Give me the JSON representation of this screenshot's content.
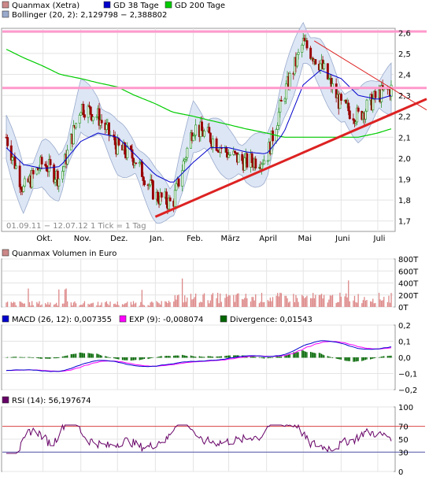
{
  "colors": {
    "candle_up": "#339933",
    "candle_down": "#990000",
    "sma38": "#0000cc",
    "sma200": "#00cc00",
    "bollinger_fill": "#dde6f5",
    "bollinger_line": "#99aacc",
    "resistance": "#ff99cc",
    "trendline": "#dd2222",
    "volume": "#dd8888",
    "macd": "#0000cc",
    "exp": "#ff00ff",
    "divergence": "#006600",
    "rsi": "#660066",
    "rsi_upper": "#dd4444",
    "rsi_lower": "#5555aa"
  },
  "chart_data": [
    {
      "type": "candlestick",
      "legend": [
        {
          "label": "Quanmax (Xetra)",
          "swatch": "#cc8888"
        },
        {
          "label": "GD 38 Tage",
          "swatch": "#0000cc"
        },
        {
          "label": "GD 200 Tage",
          "swatch": "#00cc00"
        },
        {
          "label": "Bollinger (20, 2): 2,129798 − 2,388802",
          "swatch": "#99aacc"
        }
      ],
      "period_text": "01.09.11 − 12.07.12   1 Tick = 1 Tag",
      "x_labels": [
        "Okt.",
        "Nov.",
        "Dez.",
        "Jan.",
        "Feb.",
        "März",
        "April",
        "Mai",
        "Juni",
        "Juli"
      ],
      "y_ticks": [
        "2,6",
        "2,5",
        "2,4",
        "2,3",
        "2,2",
        "2,1",
        "2,0",
        "1,9",
        "1,8",
        "1,7"
      ],
      "y_range": [
        1.65,
        2.62
      ],
      "horizontal_lines": [
        2.605,
        2.335
      ],
      "close_series": {
        "dates": [
          "2011-09-01",
          "2011-09-15",
          "2011-10-01",
          "2011-10-15",
          "2011-11-01",
          "2011-11-15",
          "2011-12-01",
          "2011-12-15",
          "2012-01-01",
          "2012-01-15",
          "2012-02-01",
          "2012-02-15",
          "2012-03-01",
          "2012-03-15",
          "2012-04-01",
          "2012-04-15",
          "2012-05-01",
          "2012-05-15",
          "2012-06-01",
          "2012-06-15",
          "2012-07-01",
          "2012-07-12"
        ],
        "values": [
          2.1,
          1.85,
          1.98,
          1.9,
          2.25,
          2.2,
          2.05,
          2.0,
          1.82,
          1.78,
          2.15,
          2.1,
          2.02,
          1.98,
          2.0,
          2.3,
          2.55,
          2.45,
          2.25,
          2.2,
          2.3,
          2.33
        ]
      },
      "sma38": [
        2.05,
        1.97,
        1.95,
        1.96,
        2.08,
        2.12,
        2.1,
        2.02,
        1.92,
        1.88,
        1.98,
        2.05,
        2.05,
        2.03,
        2.02,
        2.12,
        2.35,
        2.42,
        2.38,
        2.3,
        2.28,
        2.3
      ],
      "sma200": [
        2.52,
        2.48,
        2.44,
        2.4,
        2.38,
        2.36,
        2.34,
        2.3,
        2.26,
        2.22,
        2.2,
        2.18,
        2.16,
        2.14,
        2.12,
        2.1,
        2.1,
        2.1,
        2.1,
        2.1,
        2.12,
        2.14
      ],
      "trendline": {
        "from": [
          "2012-01-01",
          1.72
        ],
        "to": [
          "2012-07-12",
          2.23
        ]
      }
    },
    {
      "type": "bar",
      "legend": [
        {
          "label": "Quanmax Volumen in Euro",
          "swatch": "#cc8888"
        }
      ],
      "y_ticks": [
        "800T",
        "600T",
        "400T",
        "200T",
        "0T"
      ],
      "y_range": [
        0,
        800
      ]
    },
    {
      "type": "line",
      "legend": [
        {
          "label": "MACD (26, 12): 0,007355",
          "swatch": "#0000cc"
        },
        {
          "label": "EXP (9): -0,008074",
          "swatch": "#ff00ff"
        },
        {
          "label": "Divergence: 0,01543",
          "swatch": "#006600"
        }
      ],
      "y_ticks": [
        "0,2",
        "0,1",
        "0,0",
        "−0,1",
        "−0,2"
      ],
      "y_range": [
        -0.2,
        0.2
      ]
    },
    {
      "type": "line",
      "legend": [
        {
          "label": "RSI (14): 56,197674",
          "swatch": "#660066"
        }
      ],
      "y_ticks": [
        "100",
        "70",
        "50",
        "30",
        "0"
      ],
      "y_range": [
        0,
        100
      ],
      "bands": [
        70,
        30
      ]
    }
  ]
}
